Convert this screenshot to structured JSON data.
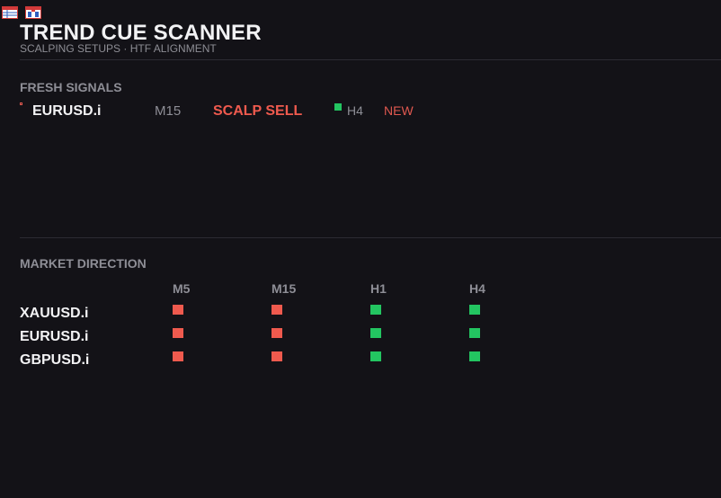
{
  "toolbar": {
    "icons": [
      "table-icon",
      "split-view-icon"
    ]
  },
  "header": {
    "title": "TREND CUE SCANNER",
    "subtitle": "SCALPING SETUPS  ·  HTF ALIGNMENT"
  },
  "colors": {
    "bull": "#23c561",
    "bear": "#ef5a4e",
    "background": "#131217"
  },
  "fresh_signals": {
    "title": "FRESH SIGNALS",
    "items": [
      {
        "symbol": "EURUSD.i",
        "timeframe": "M15",
        "action": "SCALP SELL",
        "htf_label": "H4",
        "htf_state": "bull",
        "status": "NEW"
      }
    ]
  },
  "market_direction": {
    "title": "MARKET DIRECTION",
    "timeframes": [
      "M5",
      "M15",
      "H1",
      "H4"
    ],
    "rows": [
      {
        "symbol": "XAUUSD.i",
        "states": [
          "bear",
          "bear",
          "bull",
          "bull"
        ]
      },
      {
        "symbol": "EURUSD.i",
        "states": [
          "bear",
          "bear",
          "bull",
          "bull"
        ]
      },
      {
        "symbol": "GBPUSD.i",
        "states": [
          "bear",
          "bear",
          "bull",
          "bull"
        ]
      }
    ]
  }
}
